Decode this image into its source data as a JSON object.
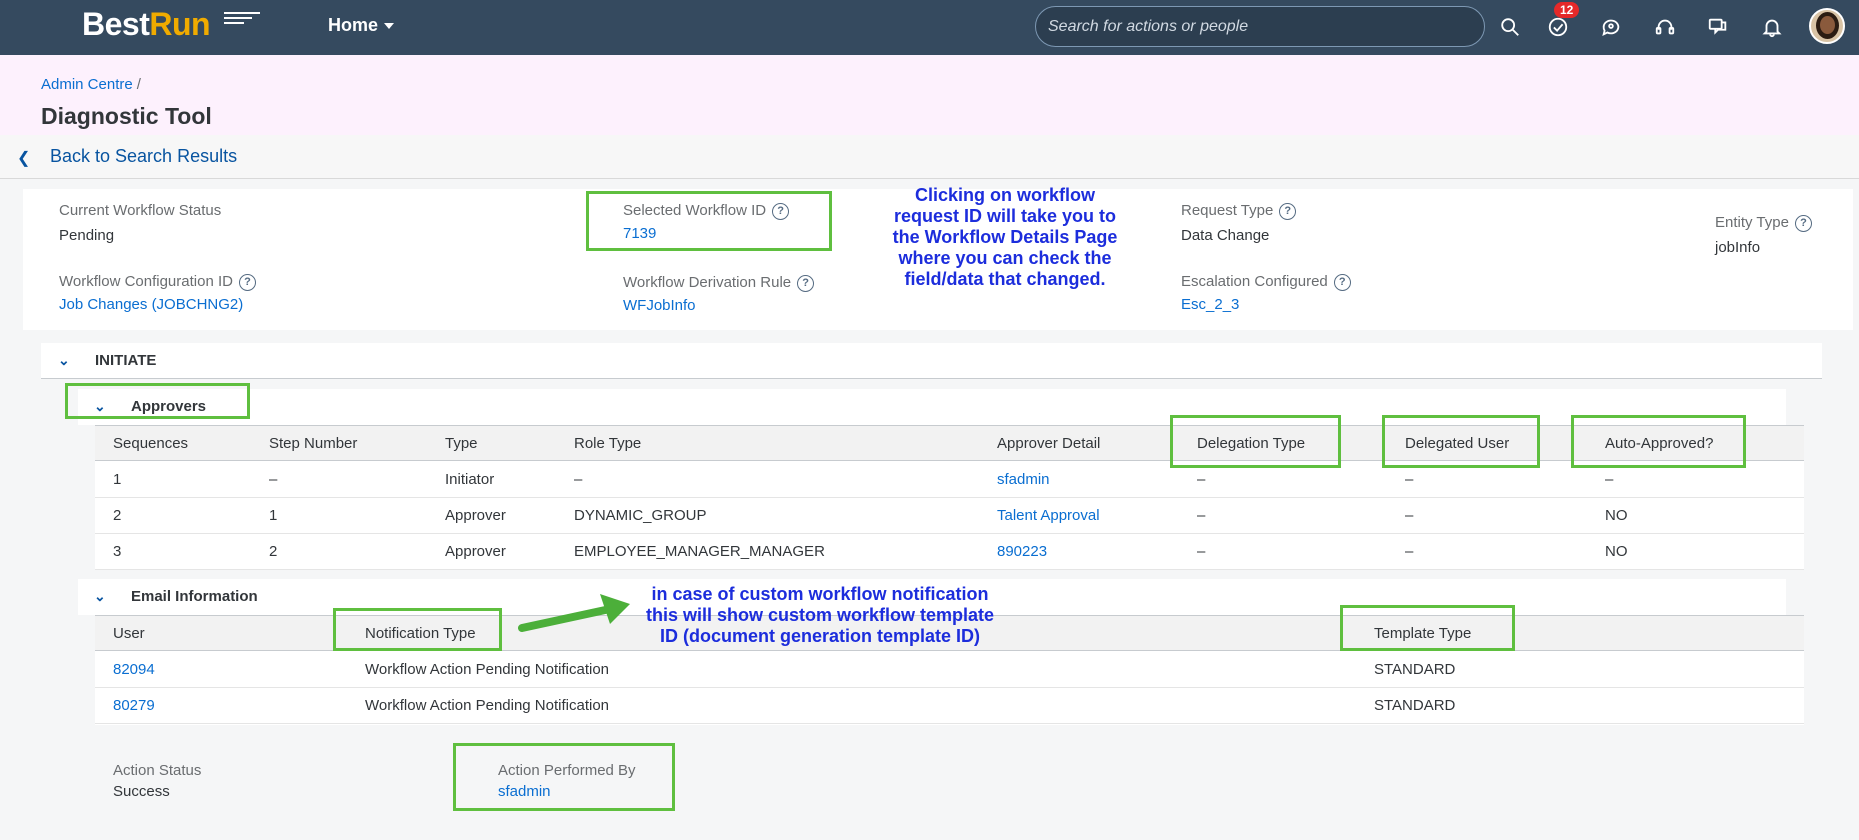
{
  "shell": {
    "logo_best": "Best",
    "logo_run": "Run",
    "home_label": "Home",
    "search_placeholder": "Search for actions or people",
    "todo_badge": "12",
    "icons": [
      "search-icon",
      "todo-check-icon",
      "chat-icon",
      "headset-icon",
      "help-bubble-icon",
      "bell-icon"
    ]
  },
  "header": {
    "breadcrumb": "Admin Centre",
    "breadcrumb_sep": "/",
    "title": "Diagnostic Tool",
    "back_label": "Back to Search Results"
  },
  "details": {
    "current_status_label": "Current Workflow Status",
    "current_status_value": "Pending",
    "selected_id_label": "Selected Workflow ID",
    "selected_id_value": "7139",
    "request_type_label": "Request Type",
    "request_type_value": "Data Change",
    "entity_type_label": "Entity Type",
    "entity_type_value": "jobInfo",
    "config_id_label": "Workflow Configuration ID",
    "config_id_value": "Job Changes (JOBCHNG2)",
    "derivation_rule_label": "Workflow Derivation Rule",
    "derivation_rule_value": "WFJobInfo",
    "escalation_label": "Escalation Configured",
    "escalation_value": "Esc_2_3"
  },
  "annotations": {
    "workflow_id_note": "Clicking on workflow request ID will take you to the Workflow Details Page where you can check the field/data that changed.",
    "template_note": "in case of custom workflow notification this will show custom workflow template ID (document generation template ID)"
  },
  "initiate": {
    "title": "INITIATE",
    "approvers": {
      "title": "Approvers",
      "columns": [
        "Sequences",
        "Step Number",
        "Type",
        "Role Type",
        "Approver Detail",
        "Delegation Type",
        "Delegated User",
        "Auto-Approved?"
      ],
      "rows": [
        [
          "1",
          "–",
          "Initiator",
          "–",
          "sfadmin",
          "–",
          "–",
          "–"
        ],
        [
          "2",
          "1",
          "Approver",
          "DYNAMIC_GROUP",
          "Talent Approval",
          "–",
          "–",
          "NO"
        ],
        [
          "3",
          "2",
          "Approver",
          "EMPLOYEE_MANAGER_MANAGER",
          "890223",
          "–",
          "–",
          "NO"
        ]
      ]
    },
    "email": {
      "title": "Email Information",
      "columns": [
        "User",
        "Notification Type",
        "Template Type"
      ],
      "rows": [
        [
          "82094",
          "Workflow Action Pending Notification",
          "STANDARD"
        ],
        [
          "80279",
          "Workflow Action Pending Notification",
          "STANDARD"
        ]
      ]
    },
    "action_status_label": "Action Status",
    "action_status_value": "Success",
    "performed_by_label": "Action Performed By",
    "performed_by_value": "sfadmin"
  },
  "colors": {
    "shell": "#354a5f",
    "link": "#0a6ed1",
    "highlight_box": "#5fbf3f",
    "annotation_text": "#1c2ddc",
    "header_band": "#fdf1fd"
  }
}
